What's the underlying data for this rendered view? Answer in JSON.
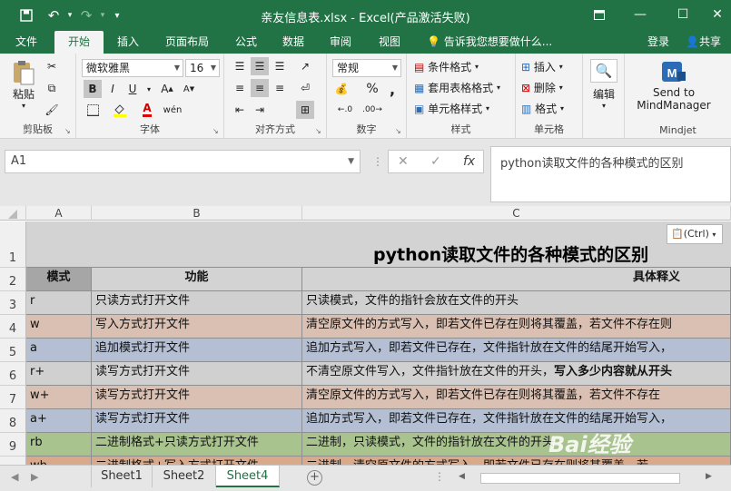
{
  "window": {
    "title": "亲友信息表.xlsx - Excel(产品激活失败)",
    "quick_access": [
      "save-icon",
      "undo-icon",
      "redo-icon",
      "customize-icon"
    ]
  },
  "ribbon_tabs": [
    "文件",
    "开始",
    "插入",
    "页面布局",
    "公式",
    "数据",
    "审阅",
    "视图"
  ],
  "active_tab": "开始",
  "tell_me": "告诉我您想要做什么...",
  "login": "登录",
  "share": "共享",
  "clipboard": {
    "paste": "粘贴",
    "label": "剪贴板"
  },
  "font": {
    "name": "微软雅黑",
    "size": "16",
    "label": "字体",
    "bold": "B",
    "italic": "I",
    "underline": "U"
  },
  "alignment": {
    "label": "对齐方式"
  },
  "number": {
    "format": "常规",
    "label": "数字",
    "percent": "%",
    "comma": ","
  },
  "styles": {
    "conditional": "条件格式",
    "table": "套用表格格式",
    "cell": "单元格样式",
    "label": "样式"
  },
  "cells": {
    "insert": "插入",
    "delete": "删除",
    "format": "格式",
    "label": "单元格"
  },
  "editing": {
    "label": "编辑"
  },
  "mindjet": {
    "send": "Send to",
    "app": "MindManager",
    "label": "Mindjet"
  },
  "formula_bar": {
    "name_box": "A1",
    "content": "python读取文件的各种模式的区别",
    "fx": "fx"
  },
  "columns": [
    "A",
    "B",
    "C"
  ],
  "sheet": {
    "title": "python读取文件的各种模式的区别",
    "headers": [
      "模式",
      "功能",
      "具体释义"
    ],
    "rows": [
      {
        "mode": "r",
        "func": "只读方式打开文件",
        "desc": "只读模式，文件的指针会放在文件的开头",
        "color": "#d0d0d0"
      },
      {
        "mode": "w",
        "func": "写入方式打开文件",
        "desc": "清空原文件的方式写入，即若文件已存在则将其覆盖，若文件不存在则",
        "color": "#d9c0b2"
      },
      {
        "mode": "a",
        "func": "追加模式打开文件",
        "desc": "追加方式写入，即若文件已存在，文件指针放在文件的结尾开始写入，",
        "color": "#b4bfd4"
      },
      {
        "mode": "r+",
        "func": "读写方式打开文件",
        "desc": "不清空原文件写入，文件指针放在文件的开头，",
        "desc_bold": "写入多少内容就从开头",
        "color": "#d0d0d0"
      },
      {
        "mode": "w+",
        "func": "读写方式打开文件",
        "desc": "清空原文件的方式写入，即若文件已存在则将其覆盖，若文件不存在",
        "color": "#d9c0b2"
      },
      {
        "mode": "a+",
        "func": "读写方式打开文件",
        "desc": "追加方式写入，即若文件已存在，文件指针放在文件的结尾开始写入，",
        "color": "#b4bfd4"
      },
      {
        "mode": "rb",
        "func": "二进制格式+只读方式打开文件",
        "desc": "二进制，只读模式，文件的指针放在文件的开头",
        "color": "#a9c38f"
      },
      {
        "mode": "wb",
        "func": "二进制格式+写入方式打开文件",
        "desc": "二进制，清空原文件的方式写入，即若文件已存在则将其覆盖，若",
        "color": "#d8a98a"
      }
    ]
  },
  "paste_options": "(Ctrl)",
  "sheet_tabs": [
    "Sheet1",
    "Sheet2",
    "Sheet4"
  ],
  "active_sheet": "Sheet4",
  "watermark": "Bai经验"
}
